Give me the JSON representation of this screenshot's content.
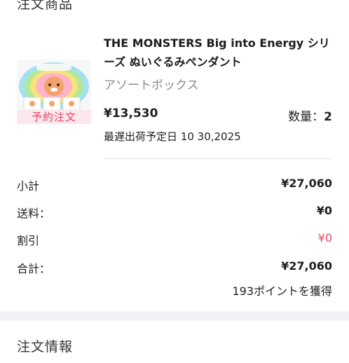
{
  "sections": {
    "order_items_title": "注文商品",
    "order_info_title": "注文情報"
  },
  "product": {
    "name": "THE MONSTERS Big into Energy シリーズ ぬいぐるみペンダント",
    "variant": "アソートボックス",
    "badge": "予約注文",
    "price": "¥13,530",
    "quantity_label": "数量：",
    "quantity_value": "2",
    "ship_label": "最遅出荷予定日",
    "ship_date": "10 30,2025"
  },
  "summary": {
    "subtotal_label": "小計",
    "subtotal_value": "¥27,060",
    "shipping_label": "送料：",
    "shipping_value": "¥0",
    "discount_label": "割引",
    "discount_value": "¥0",
    "total_label": "合計：",
    "total_value": "¥27,060",
    "points": "193ポイントを獲得"
  },
  "colors": {
    "accent_pink": "#e8486b",
    "badge_bg": "#fbe7ec",
    "page_bg": "#f2f2f4"
  }
}
